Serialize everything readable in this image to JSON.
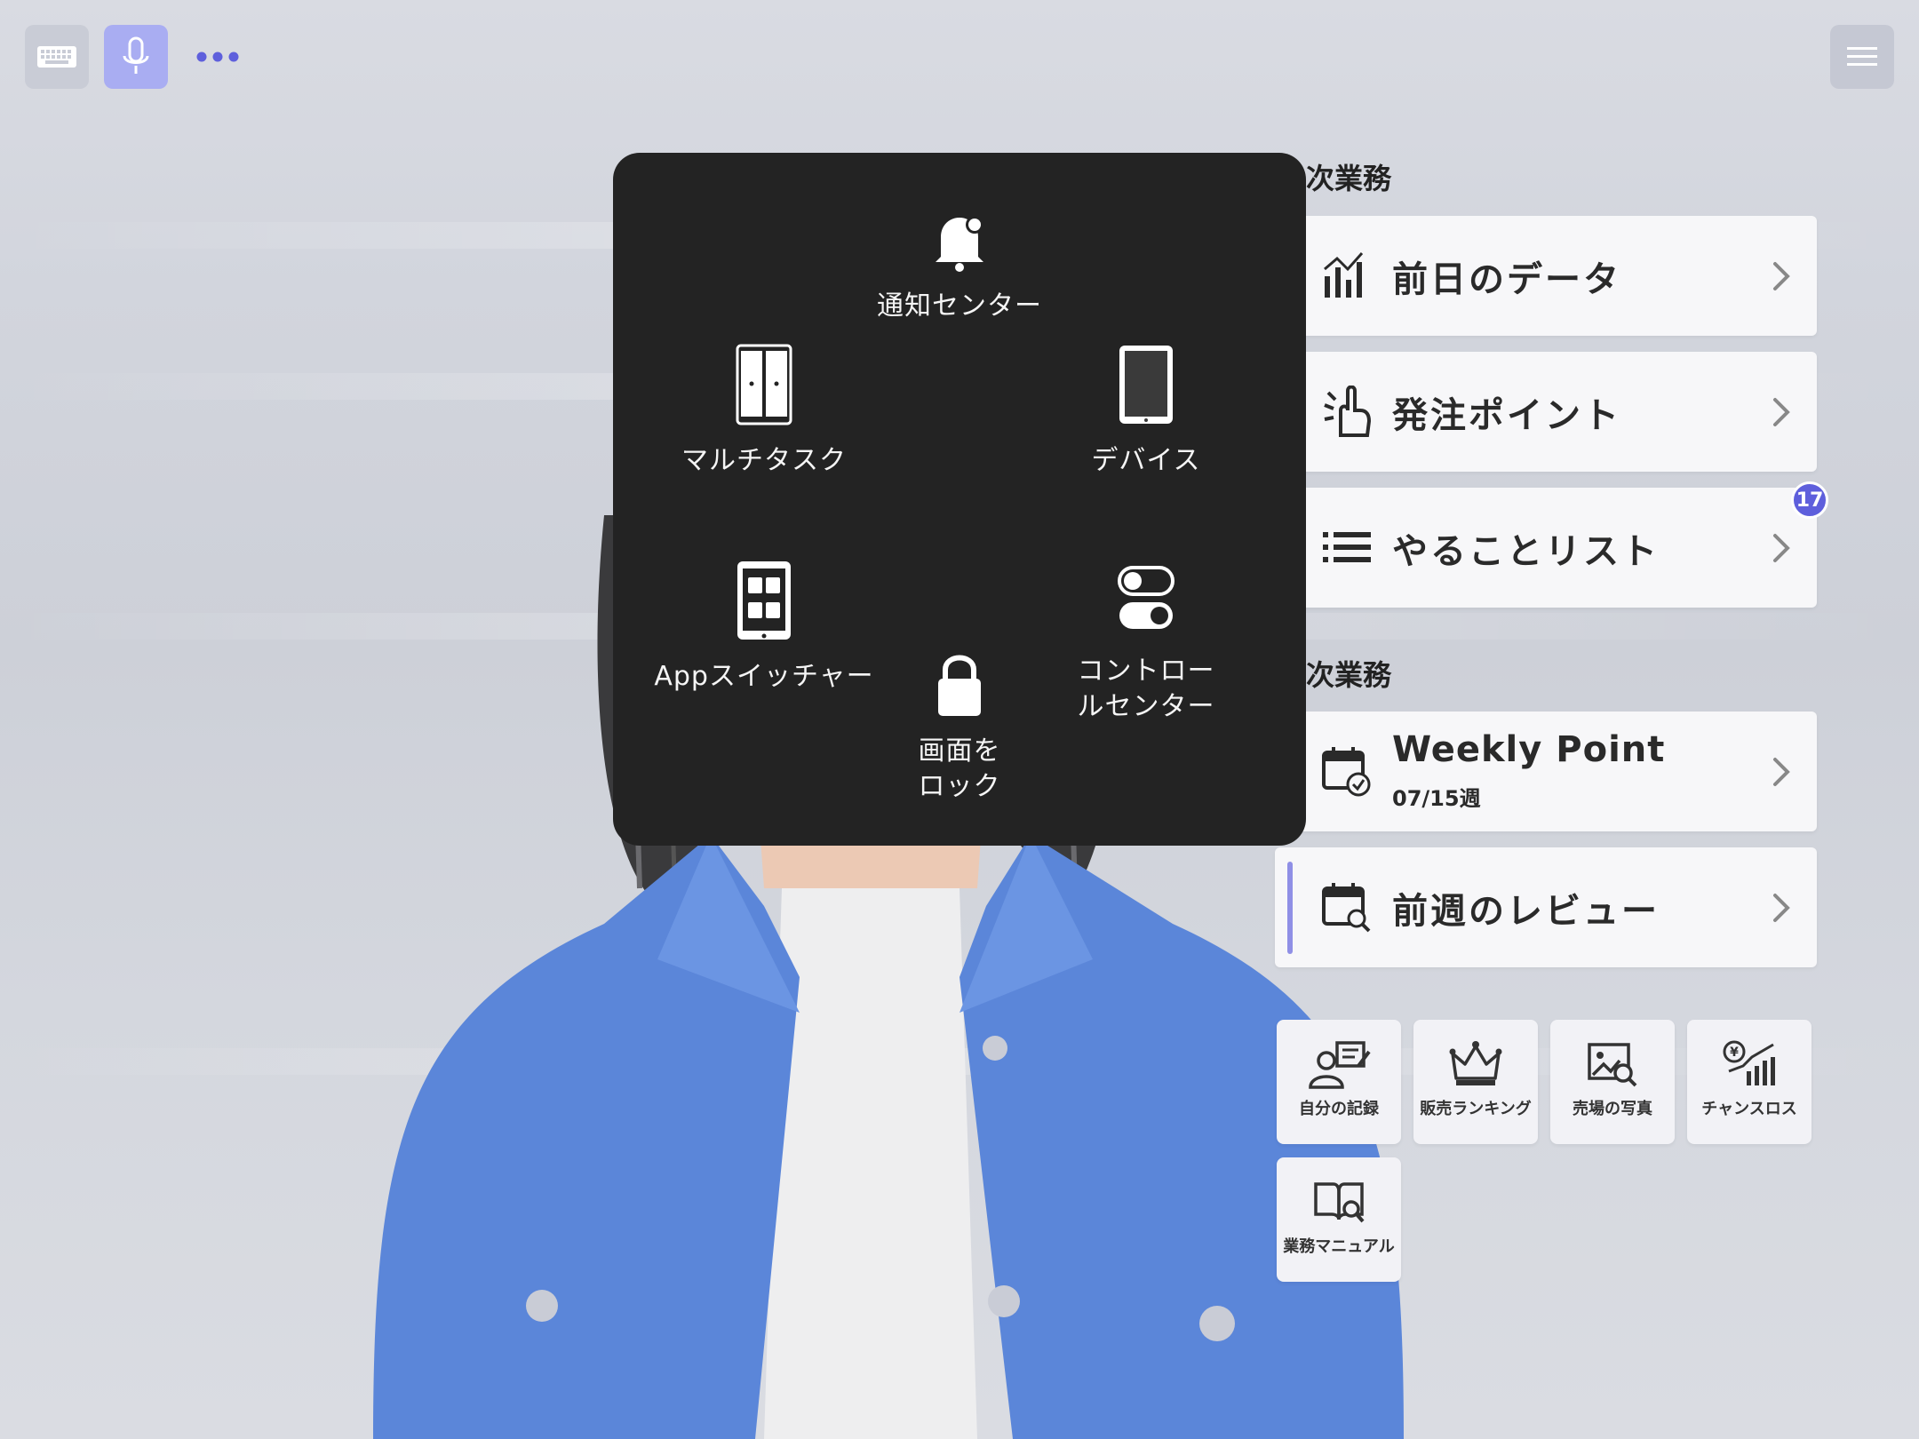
{
  "toolbar": {
    "keyboard_icon": "keyboard-icon",
    "mic_icon": "microphone-icon",
    "more_icon": "ellipsis-icon",
    "menu_icon": "hamburger-menu-icon"
  },
  "assistive_touch": {
    "notification_center": "通知センター",
    "multitask": "マルチタスク",
    "device": "デバイス",
    "app_switcher": "Appスイッチャー",
    "lock_screen": "画面を\nロック",
    "control_center": "コントロー\nルセンター"
  },
  "daily": {
    "section_title": "次業務",
    "items": [
      {
        "label": "前日のデータ",
        "icon": "bar-chart-icon"
      },
      {
        "label": "発注ポイント",
        "icon": "pointing-hand-icon"
      },
      {
        "label": "やることリスト",
        "icon": "list-icon",
        "badge": "17"
      }
    ]
  },
  "weekly": {
    "section_title": "次業務",
    "items": [
      {
        "label": "Weekly Point",
        "sub": "07/15週",
        "icon": "calendar-check-icon"
      },
      {
        "label": "前週のレビュー",
        "icon": "calendar-search-icon"
      }
    ]
  },
  "tiles": [
    {
      "label": "自分の記録",
      "icon": "person-note-icon"
    },
    {
      "label": "販売ランキング",
      "icon": "crown-icon"
    },
    {
      "label": "売場の写真",
      "icon": "photo-search-icon"
    },
    {
      "label": "チャンスロス",
      "icon": "yen-chart-icon"
    },
    {
      "label": "業務マニュアル",
      "icon": "book-search-icon"
    }
  ],
  "colors": {
    "accent": "#5e5fdc",
    "mic_active": "#a9adf2",
    "panel_bg": "#232323",
    "card_bg": "#f7f7f9",
    "jacket": "#5b86d9"
  }
}
